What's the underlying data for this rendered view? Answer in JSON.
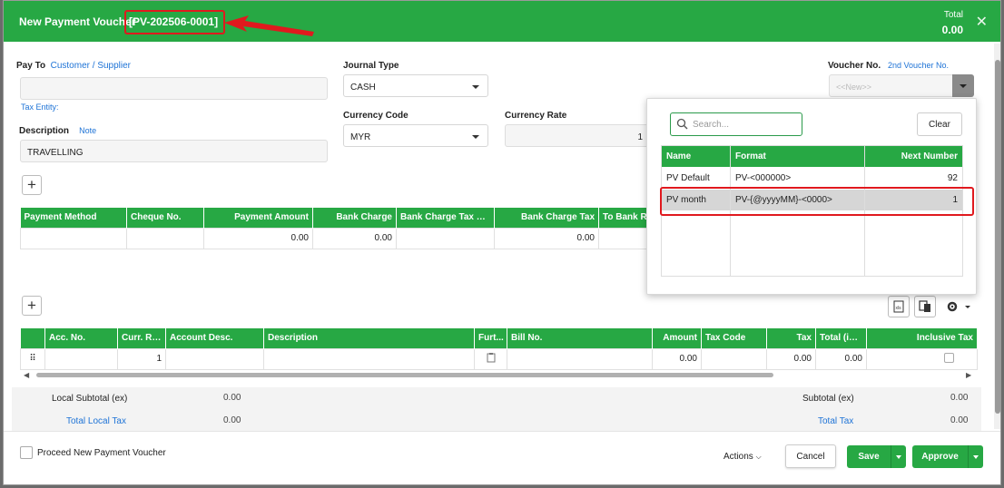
{
  "header": {
    "title_prefix": "New Payment Voucher",
    "voucher_no": "[PV-202506-0001]",
    "total_label": "Total",
    "total_value": "0.00",
    "close_icon": "close-icon"
  },
  "form": {
    "pay_to_label": "Pay To",
    "customer_link": "Customer",
    "slash": "/",
    "supplier_link": "Supplier",
    "pay_to_value": "",
    "tax_entity_link": "Tax Entity:",
    "description_label": "Description",
    "note_link": "Note",
    "description_value": "TRAVELLING",
    "journal_type_label": "Journal Type",
    "journal_type_value": "CASH",
    "currency_code_label": "Currency Code",
    "currency_code_value": "MYR",
    "currency_rate_label": "Currency Rate",
    "currency_rate_value": "1",
    "voucher_no_label": "Voucher No.",
    "second_voucher_link": "2nd Voucher No.",
    "voucher_no_placeholder": "<<New>>"
  },
  "payment_table": {
    "columns": [
      "Payment Method",
      "Cheque No.",
      "Payment Amount",
      "Bank Charge",
      "Bank Charge Tax Code",
      "Bank Charge Tax",
      "To Bank Ra"
    ],
    "row": [
      "",
      "",
      "0.00",
      "0.00",
      "",
      "0.00",
      ""
    ]
  },
  "detail_table": {
    "columns": [
      "",
      "Acc. No.",
      "Curr. Rate",
      "Account Desc.",
      "Description",
      "Furt...",
      "Bill No.",
      "Amount",
      "Tax Code",
      "Tax",
      "Total (inc)",
      "Inclusive Tax"
    ],
    "row": [
      "",
      "",
      "1",
      "",
      "",
      "",
      "",
      "0.00",
      "",
      "0.00",
      "0.00",
      ""
    ]
  },
  "totals": {
    "local_subtotal_label": "Local Subtotal (ex)",
    "local_subtotal_value": "0.00",
    "total_local_tax_label": "Total Local Tax",
    "total_local_tax_value": "0.00",
    "subtotal_label": "Subtotal (ex)",
    "subtotal_value": "0.00",
    "total_tax_label": "Total Tax",
    "total_tax_value": "0.00"
  },
  "popup": {
    "search_placeholder": "Search...",
    "clear_label": "Clear",
    "columns": [
      "Name",
      "Format",
      "Next Number"
    ],
    "rows": [
      {
        "name": "PV Default",
        "format": "PV-<000000>",
        "next": "92"
      },
      {
        "name": "PV month",
        "format": "PV-{@yyyyMM}-<0000>",
        "next": "1"
      }
    ]
  },
  "footer": {
    "proceed_label": "Proceed New Payment Voucher",
    "actions_label": "Actions",
    "cancel_label": "Cancel",
    "save_label": "Save",
    "approve_label": "Approve"
  },
  "colors": {
    "brand_green": "#27a844",
    "highlight_red": "#e0191e",
    "link_blue": "#1e73d6"
  }
}
